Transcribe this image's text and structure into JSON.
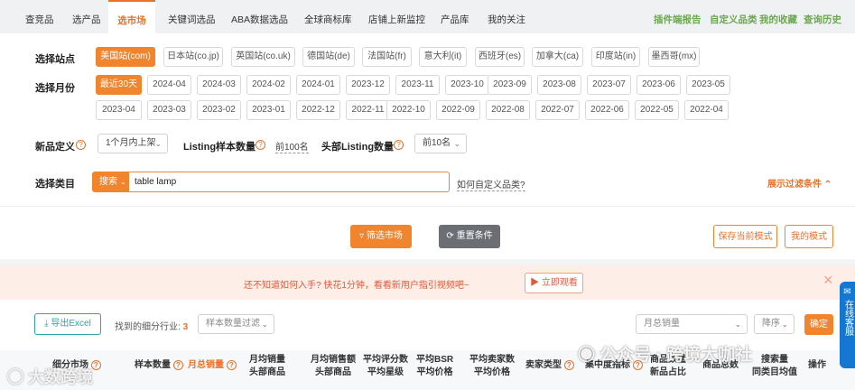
{
  "nav": {
    "tabs": [
      "查竞品",
      "选产品",
      "选市场",
      "关键词选品",
      "ABA数据选品",
      "全球商标库",
      "店铺上新监控",
      "产品库",
      "我的关注"
    ],
    "active_index": 2,
    "right_links": [
      "插件端报告",
      "自定义品类",
      "我的收藏",
      "查询历史"
    ]
  },
  "filters": {
    "site_label": "选择站点",
    "sites": [
      "美国站(com)",
      "日本站(co.jp)",
      "英国站(co.uk)",
      "德国站(de)",
      "法国站(fr)",
      "意大利(it)",
      "西班牙(es)",
      "加拿大(ca)",
      "印度站(in)",
      "墨西哥(mx)"
    ],
    "month_label": "选择月份",
    "months_row1": [
      "最近30天",
      "2024-04",
      "2024-03",
      "2024-02",
      "2024-01",
      "2023-12",
      "2023-11",
      "2023-10",
      "2023-09",
      "2023-08",
      "2023-07",
      "2023-06",
      "2023-05"
    ],
    "months_row2": [
      "2023-04",
      "2023-03",
      "2023-02",
      "2023-01",
      "2022-12",
      "2022-11",
      "2022-10",
      "2022-09",
      "2022-08",
      "2022-07",
      "2022-06",
      "2022-05",
      "2022-04"
    ],
    "new_label": "新品定义",
    "new_value": "1个月内上架",
    "listing_label": "Listing样本数量",
    "listing_value": "前100名",
    "head_label": "头部Listing数量",
    "head_value": "前10名",
    "category_label": "选择类目",
    "search_mode": "搜索",
    "search_value": "table lamp",
    "custom_help": "如何自定义品类?",
    "show_filters": "展示过滤条件"
  },
  "actions": {
    "filter_btn": "筛选市场",
    "reset_btn": "重置条件",
    "save_mode": "保存当前模式",
    "my_mode": "我的模式"
  },
  "banner": {
    "text": "还不知道如何入手? 快花1分钟，看看新用户指引视频吧~",
    "watch": "立即观看",
    "close": "×"
  },
  "results": {
    "export": "导出Excel",
    "found_prefix": "找到的细分行业:",
    "found_count": "3",
    "sample_filter": "样本数量过滤",
    "sort_field": "月总销量",
    "sort_order": "降序",
    "confirm": "确定",
    "cols": [
      {
        "l1": "细分市场",
        "l2": ""
      },
      {
        "l1": "样本数量",
        "l2": ""
      },
      {
        "l1": "月总销量",
        "l2": ""
      },
      {
        "l1": "月均销量",
        "l2": "头部商品"
      },
      {
        "l1": "月均销售额",
        "l2": "头部商品"
      },
      {
        "l1": "平均评分数",
        "l2": "平均星级"
      },
      {
        "l1": "平均BSR",
        "l2": "平均价格"
      },
      {
        "l1": "平均卖家数",
        "l2": "平均价格"
      },
      {
        "l1": "卖家类型",
        "l2": ""
      },
      {
        "l1": "集中度指标",
        "l2": ""
      },
      {
        "l1": "商品数量",
        "l2": "新品占比"
      },
      {
        "l1": "商品总数",
        "l2": ""
      },
      {
        "l1": "搜索量",
        "l2": "同类目均值"
      },
      {
        "l1": "操作",
        "l2": ""
      }
    ]
  },
  "watermark": {
    "left": "大数跨境",
    "right": "公众号 · 跨境大咖社"
  },
  "side_widget": "在线客服"
}
